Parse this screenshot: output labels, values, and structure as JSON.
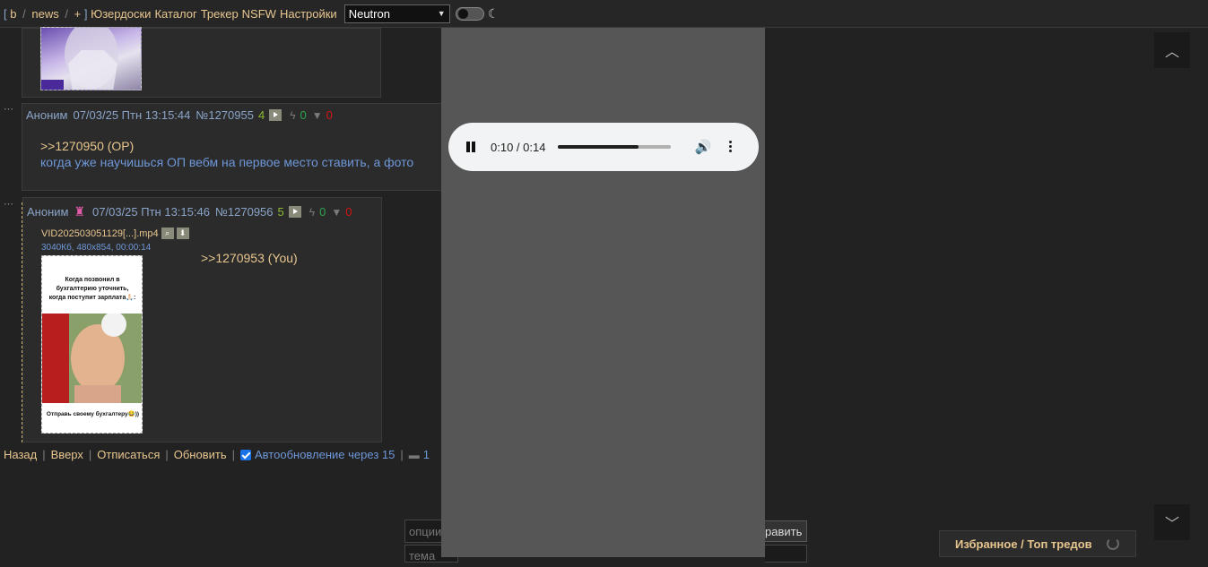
{
  "topbar": {
    "boards": [
      "b",
      "news",
      "+"
    ],
    "links": [
      "Юзердоски",
      "Каталог",
      "Трекер",
      "NSFW",
      "Настройки"
    ],
    "style_select_value": "Neutron"
  },
  "posts": [
    {
      "author": "Аноним",
      "date": "07/03/25 Птн 13:15:44",
      "number": "№1270955",
      "reply_count": "4",
      "likes": "0",
      "dislikes": "0",
      "reply_link": ">>1270950 (OP)",
      "text": "когда уже научишься ОП вебм на первое место ставить, а фото"
    },
    {
      "author": "Аноним",
      "date": "07/03/25 Птн 13:15:46",
      "number": "№1270956",
      "reply_count": "5",
      "likes": "0",
      "dislikes": "0",
      "file_name": "VID202503051129[...].mp4",
      "file_info": "3040Кб, 480x854, 00:00:14",
      "reply_link": ">>1270953 (You)",
      "image_caption_top": "Когда позвонил в бухгалтерию уточнить, когда поступит зарплата🙏🏻:",
      "image_caption_bottom": "Отправь своему бухгалтеру😂))"
    }
  ],
  "bottom_links": {
    "back": "Назад",
    "up": "Вверх",
    "unsubscribe": "Отписаться",
    "refresh": "Обновить",
    "autoupdate": "Автообновление через 15",
    "count": "1"
  },
  "audio": {
    "time": "0:10 / 0:14",
    "progress": 0.71
  },
  "form": {
    "options_placeholder": "опции",
    "subject_placeholder": "тема",
    "submit": "равить"
  },
  "favorites": {
    "label": "Избранное / Топ тредов"
  },
  "colors": {
    "link": "#e8c68f",
    "accent_blue": "#6e97d8",
    "likes": "#2ea44f",
    "dislikes": "#d41515"
  }
}
